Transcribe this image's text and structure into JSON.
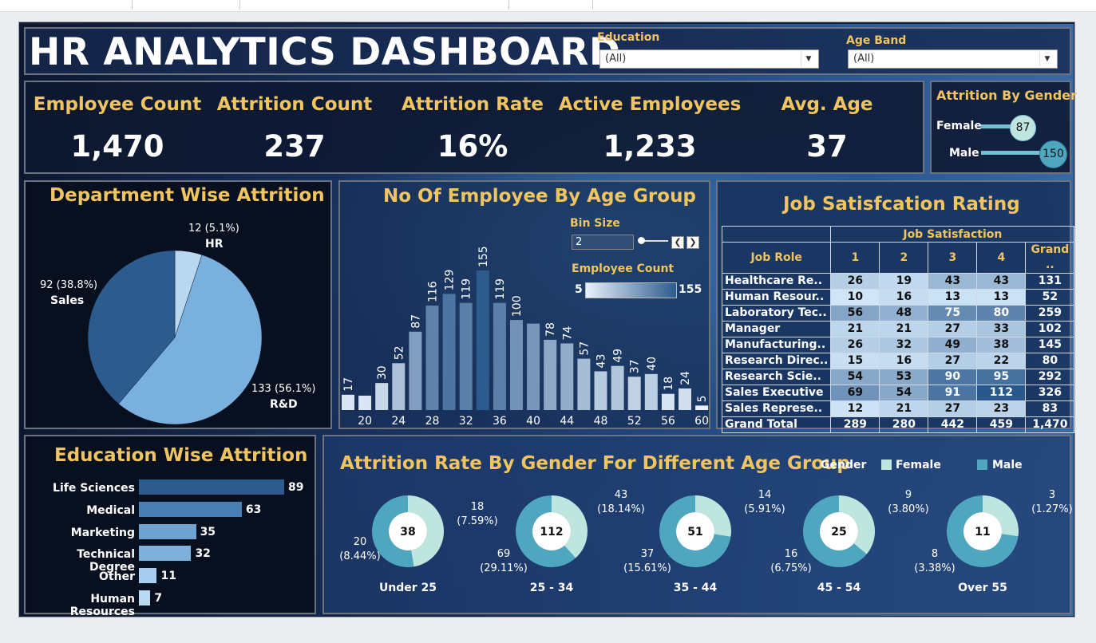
{
  "dashboard": {
    "title": "HR ANALYTICS DASHBOARD"
  },
  "filters": {
    "education": {
      "label": "Education",
      "value": "(All)"
    },
    "age_band": {
      "label": "Age Band",
      "value": "(All)"
    }
  },
  "kpis": [
    {
      "title": "Employee Count",
      "value": "1,470"
    },
    {
      "title": "Attrition Count",
      "value": "237"
    },
    {
      "title": "Attrition Rate",
      "value": "16%"
    },
    {
      "title": "Active Employees",
      "value": "1,233"
    },
    {
      "title": "Avg. Age",
      "value": "37"
    }
  ],
  "gender_attrition": {
    "title": "Attrition By Gender",
    "items": [
      {
        "label": "Female",
        "value": 87,
        "display": "87"
      },
      {
        "label": "Male",
        "value": 150,
        "display": "150"
      }
    ]
  },
  "department": {
    "title": "Department Wise Attrition",
    "slices": [
      {
        "name": "HR",
        "value": 12,
        "label": "12 (5.1%)",
        "color": "#b7d8f0"
      },
      {
        "name": "R&D",
        "value": 133,
        "label": "133 (56.1%)",
        "color": "#7ab0de"
      },
      {
        "name": "Sales",
        "value": 92,
        "label": "92 (38.8%)",
        "color": "#2c5b8d"
      }
    ]
  },
  "age_group": {
    "title": "No Of Employee By Age Group",
    "bin_size_label": "Bin Size",
    "bin_size_value": "2",
    "legend_title": "Employee Count",
    "legend_min": "5",
    "legend_max": "155"
  },
  "chart_data": [
    {
      "type": "bar",
      "title": "No Of Employee By Age Group",
      "categories": [
        "18",
        "20",
        "22",
        "24",
        "26",
        "28",
        "30",
        "32",
        "34",
        "36",
        "38",
        "40",
        "42",
        "44",
        "46",
        "48",
        "50",
        "52",
        "54",
        "56",
        "58",
        "60"
      ],
      "values": [
        17,
        16,
        30,
        52,
        87,
        116,
        129,
        119,
        155,
        119,
        100,
        96,
        78,
        74,
        57,
        43,
        49,
        37,
        40,
        18,
        24,
        5
      ],
      "tick_labels": [
        "20",
        "24",
        "28",
        "32",
        "36",
        "40",
        "44",
        "48",
        "52",
        "56",
        "60"
      ],
      "show_value_labels": [
        true,
        false,
        true,
        true,
        true,
        true,
        true,
        true,
        true,
        true,
        true,
        false,
        true,
        true,
        true,
        true,
        true,
        true,
        true,
        true,
        true,
        true
      ]
    },
    {
      "type": "pie",
      "title": "Department Wise Attrition",
      "categories": [
        "HR",
        "R&D",
        "Sales"
      ],
      "values": [
        12,
        133,
        92
      ]
    },
    {
      "type": "bar",
      "title": "Education Wise Attrition",
      "categories": [
        "Life Sciences",
        "Medical",
        "Marketing",
        "Technical Degree",
        "Other",
        "Human Resources"
      ],
      "values": [
        89,
        63,
        35,
        32,
        11,
        7
      ]
    }
  ],
  "job_satisfaction": {
    "title": "Job Satisfcation Rating",
    "col_group": "Job Satisfaction",
    "row_header": "Job Role",
    "columns": [
      "1",
      "2",
      "3",
      "4",
      "Grand .."
    ],
    "rows": [
      {
        "role": "Healthcare Re..",
        "values": [
          26,
          19,
          43,
          43
        ],
        "total": "131"
      },
      {
        "role": "Human Resour..",
        "values": [
          10,
          16,
          13,
          13
        ],
        "total": "52"
      },
      {
        "role": "Laboratory Tec..",
        "values": [
          56,
          48,
          75,
          80
        ],
        "total": "259"
      },
      {
        "role": "Manager",
        "values": [
          21,
          21,
          27,
          33
        ],
        "total": "102"
      },
      {
        "role": "Manufacturing..",
        "values": [
          26,
          32,
          49,
          38
        ],
        "total": "145"
      },
      {
        "role": "Research Direc..",
        "values": [
          15,
          16,
          27,
          22
        ],
        "total": "80"
      },
      {
        "role": "Research Scie..",
        "values": [
          54,
          53,
          90,
          95
        ],
        "total": "292"
      },
      {
        "role": "Sales Executive",
        "values": [
          69,
          54,
          91,
          112
        ],
        "total": "326"
      },
      {
        "role": "Sales Represe..",
        "values": [
          12,
          21,
          27,
          23
        ],
        "total": "83"
      }
    ],
    "grand_total": {
      "label": "Grand Total",
      "values": [
        "289",
        "280",
        "442",
        "459"
      ],
      "total": "1,470"
    }
  },
  "education": {
    "title": "Education Wise Attrition",
    "items": [
      {
        "label": "Life Sciences",
        "value": 89,
        "display": "89"
      },
      {
        "label": "Medical",
        "value": 63,
        "display": "63"
      },
      {
        "label": "Marketing",
        "value": 35,
        "display": "35"
      },
      {
        "label": "Technical Degree",
        "value": 32,
        "display": "32"
      },
      {
        "label": "Other",
        "value": 11,
        "display": "11"
      },
      {
        "label": "Human Resources",
        "value": 7,
        "display": "7"
      }
    ]
  },
  "gender_age": {
    "title": "Attrition Rate By Gender For Different Age Group",
    "legend_title": "Gender",
    "legend": [
      {
        "label": "Female",
        "color": "#bfe6de"
      },
      {
        "label": "Male",
        "color": "#4fa7bf"
      }
    ],
    "groups": [
      {
        "name": "Under 25",
        "total": "38",
        "female": 18,
        "male": 20,
        "female_label": "18\n(7.59%)",
        "male_label": "20\n(8.44%)"
      },
      {
        "name": "25 - 34",
        "total": "112",
        "female": 43,
        "male": 69,
        "female_label": "43\n(18.14%)",
        "male_label": "69\n(29.11%)"
      },
      {
        "name": "35 - 44",
        "total": "51",
        "female": 14,
        "male": 37,
        "female_label": "14\n(5.91%)",
        "male_label": "37\n(15.61%)"
      },
      {
        "name": "45 - 54",
        "total": "25",
        "female": 9,
        "male": 16,
        "female_label": "9\n(3.80%)",
        "male_label": "16\n(6.75%)"
      },
      {
        "name": "Over 55",
        "total": "11",
        "female": 3,
        "male": 8,
        "female_label": "3\n(1.27%)",
        "male_label": "8\n(3.38%)"
      }
    ]
  }
}
